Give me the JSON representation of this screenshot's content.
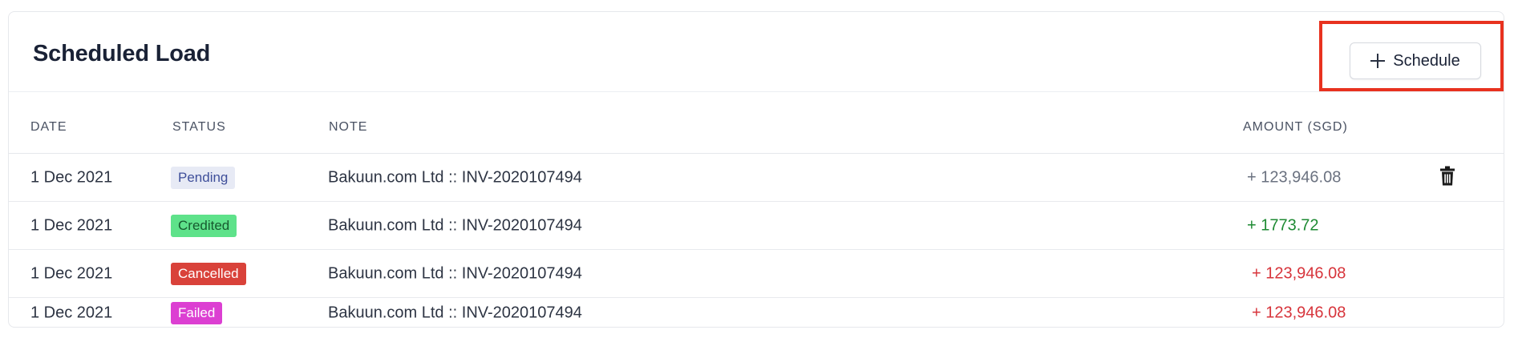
{
  "header": {
    "title": "Scheduled Load",
    "schedule_label": "Schedule"
  },
  "table": {
    "columns": [
      "DATE",
      "STATUS",
      "NOTE",
      "AMOUNT (SGD)"
    ],
    "rows": [
      {
        "date": "1 Dec 2021",
        "status": "Pending",
        "note": "Bakuun.com Ltd :: INV-2020107494",
        "amount": "+ 123,946.08"
      },
      {
        "date": "1 Dec 2021",
        "status": "Credited",
        "note": "Bakuun.com Ltd :: INV-2020107494",
        "amount": "+ 1773.72"
      },
      {
        "date": "1 Dec 2021",
        "status": "Cancelled",
        "note": "Bakuun.com Ltd :: INV-2020107494",
        "amount": "+ 123,946.08"
      },
      {
        "date": "1 Dec 2021",
        "status": "Failed",
        "note": "Bakuun.com Ltd :: INV-2020107494",
        "amount": "+ 123,946.08"
      }
    ]
  },
  "colors": {
    "pending_bg": "#e7eaf5",
    "credited_bg": "#5ee28a",
    "cancelled_bg": "#d9423a",
    "failed_bg": "#dc3fd2",
    "highlight": "#e8321f"
  },
  "icons": {
    "schedule": "plus-icon",
    "row_action": "trash-icon"
  }
}
